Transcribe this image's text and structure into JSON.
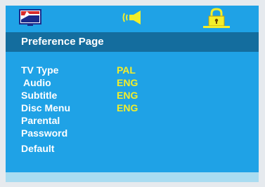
{
  "tabs": [
    {
      "icon": "tv-general-icon",
      "selected": false
    },
    {
      "icon": "audio-speaker-icon",
      "selected": false
    },
    {
      "icon": "lock-icon",
      "selected": true
    }
  ],
  "header": {
    "title": "Preference Page"
  },
  "menu": {
    "items": [
      {
        "label": "TV Type",
        "value": "PAL"
      },
      {
        "label": "Audio",
        "value": "ENG"
      },
      {
        "label": "Subtitle",
        "value": "ENG"
      },
      {
        "label": "Disc Menu",
        "value": "ENG"
      },
      {
        "label": "Parental",
        "value": ""
      },
      {
        "label": "Password",
        "value": ""
      },
      {
        "label": "Default",
        "value": ""
      }
    ]
  },
  "colors": {
    "background": "#1fa2e6",
    "header_bar": "#146d9e",
    "value_text": "#f3ee2a",
    "label_text": "#ffffff",
    "footer_bar": "#a9dcf1"
  }
}
